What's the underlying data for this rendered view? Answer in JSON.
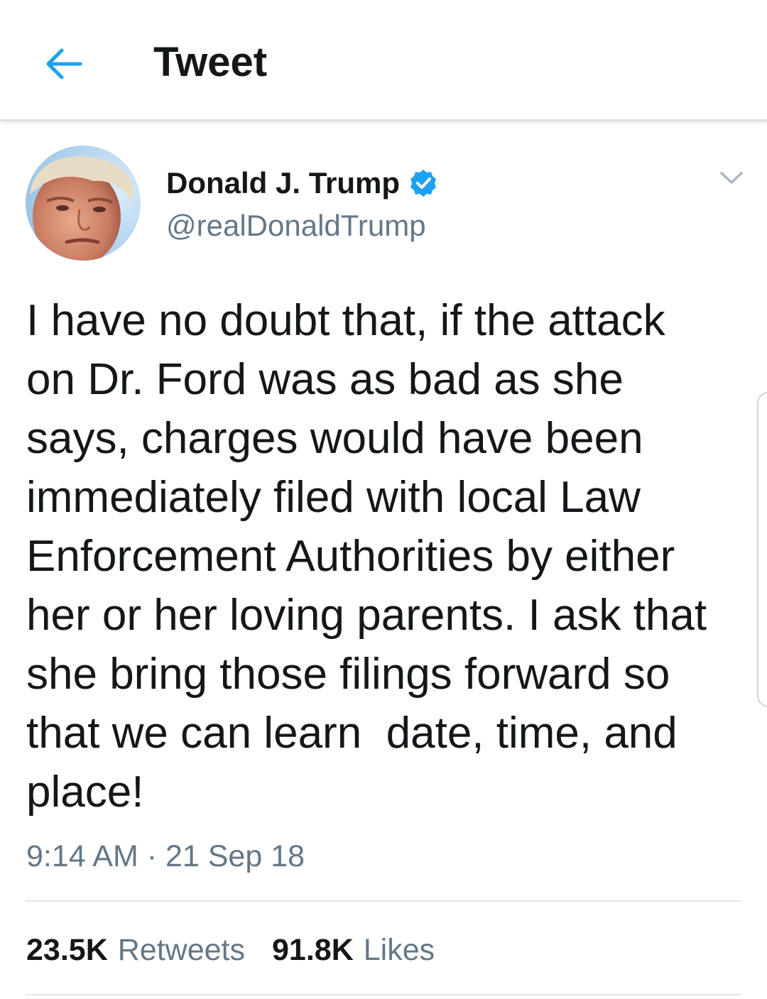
{
  "header": {
    "title": "Tweet",
    "back_icon": "back-arrow-icon",
    "accent": "#1da1f2"
  },
  "tweet": {
    "author_name": "Donald J. Trump",
    "handle": "@realDonaldTrump",
    "verified": true,
    "avatar_icon": "profile-photo",
    "menu_icon": "chevron-down-icon",
    "text": "I have no doubt that, if the attack\non Dr. Ford was as bad as she\nsays, charges would have been\nimmediately filed with local Law\nEnforcement Authorities by either\nher or her loving parents. I ask that\nshe bring those filings forward so\nthat we can learn  date, time, and\nplace!",
    "timestamp": "9:14 AM · 21 Sep 18"
  },
  "stats": {
    "retweets_count": "23.5K",
    "retweets_label": "Retweets",
    "likes_count": "91.8K",
    "likes_label": "Likes"
  },
  "colors": {
    "text_primary": "#14171a",
    "text_secondary": "#657786",
    "verified_badge": "#1da1f2",
    "divider": "#e1e8ed"
  }
}
